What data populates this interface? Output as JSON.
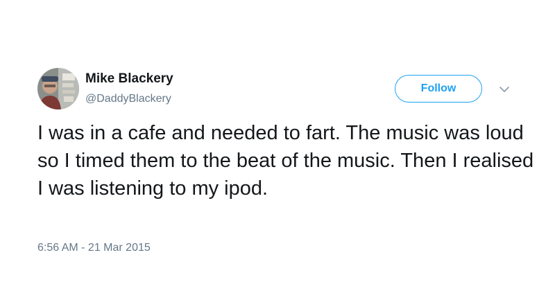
{
  "tweet": {
    "author": {
      "display_name": "Mike Blackery",
      "handle": "@DaddyBlackery",
      "avatar_icon": "avatar-photo"
    },
    "follow_label": "Follow",
    "caret_icon": "chevron-down-icon",
    "text": "I was in a cafe and needed to fart. The music was loud so I timed them to the beat of the music. Then I realised I was listening to my ipod.",
    "timestamp": "6:56 AM - 21 Mar 2015"
  },
  "colors": {
    "accent": "#1da1f2",
    "text_primary": "#14171a",
    "text_secondary": "#657786",
    "background": "#ffffff"
  }
}
